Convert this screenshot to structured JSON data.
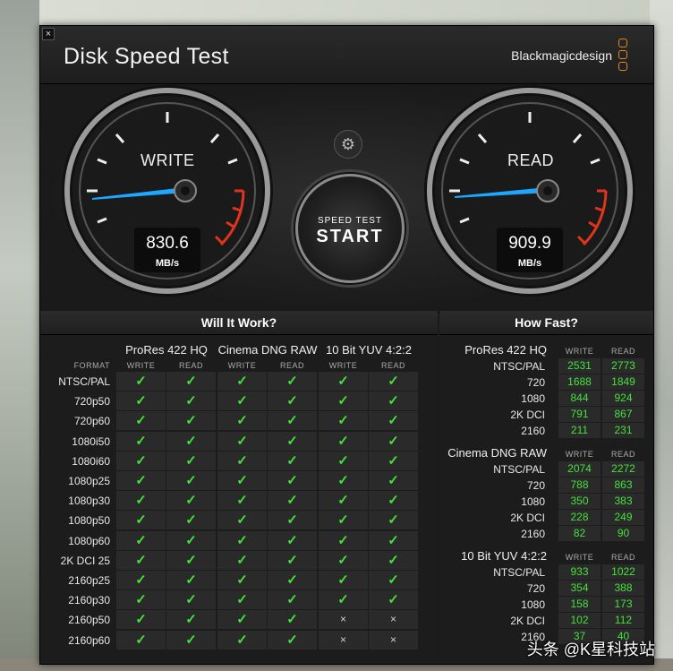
{
  "window": {
    "title": "Disk Speed Test",
    "brand": "Blackmagicdesign",
    "close_label": "×"
  },
  "gauges": {
    "write": {
      "label": "WRITE",
      "value": "830.6",
      "unit": "MB/s"
    },
    "read": {
      "label": "READ",
      "value": "909.9",
      "unit": "MB/s"
    }
  },
  "start_button": {
    "line1": "SPEED TEST",
    "line2": "START"
  },
  "settings_icon": "gear-icon",
  "will_it_work": {
    "header": "Will It Work?",
    "format_label": "FORMAT",
    "codecs": [
      "ProRes 422 HQ",
      "Cinema DNG RAW",
      "10 Bit YUV 4:2:2"
    ],
    "col_labels": [
      "WRITE",
      "READ"
    ],
    "rows": [
      {
        "format": "NTSC/PAL",
        "marks": [
          1,
          1,
          1,
          1,
          1,
          1
        ]
      },
      {
        "format": "720p50",
        "marks": [
          1,
          1,
          1,
          1,
          1,
          1
        ]
      },
      {
        "format": "720p60",
        "marks": [
          1,
          1,
          1,
          1,
          1,
          1
        ]
      },
      {
        "format": "1080i50",
        "marks": [
          1,
          1,
          1,
          1,
          1,
          1
        ]
      },
      {
        "format": "1080i60",
        "marks": [
          1,
          1,
          1,
          1,
          1,
          1
        ]
      },
      {
        "format": "1080p25",
        "marks": [
          1,
          1,
          1,
          1,
          1,
          1
        ]
      },
      {
        "format": "1080p30",
        "marks": [
          1,
          1,
          1,
          1,
          1,
          1
        ]
      },
      {
        "format": "1080p50",
        "marks": [
          1,
          1,
          1,
          1,
          1,
          1
        ]
      },
      {
        "format": "1080p60",
        "marks": [
          1,
          1,
          1,
          1,
          1,
          1
        ]
      },
      {
        "format": "2K DCI 25",
        "marks": [
          1,
          1,
          1,
          1,
          1,
          1
        ]
      },
      {
        "format": "2160p25",
        "marks": [
          1,
          1,
          1,
          1,
          1,
          1
        ]
      },
      {
        "format": "2160p30",
        "marks": [
          1,
          1,
          1,
          1,
          1,
          1
        ]
      },
      {
        "format": "2160p50",
        "marks": [
          1,
          1,
          1,
          1,
          0,
          0
        ]
      },
      {
        "format": "2160p60",
        "marks": [
          1,
          1,
          1,
          1,
          0,
          0
        ]
      }
    ],
    "check_symbol": "✓",
    "cross_symbol": "×"
  },
  "how_fast": {
    "header": "How Fast?",
    "col_labels": [
      "WRITE",
      "READ"
    ],
    "groups": [
      {
        "codec": "ProRes 422 HQ",
        "rows": [
          {
            "format": "NTSC/PAL",
            "write": "2531",
            "read": "2773"
          },
          {
            "format": "720",
            "write": "1688",
            "read": "1849"
          },
          {
            "format": "1080",
            "write": "844",
            "read": "924"
          },
          {
            "format": "2K DCI",
            "write": "791",
            "read": "867"
          },
          {
            "format": "2160",
            "write": "211",
            "read": "231"
          }
        ]
      },
      {
        "codec": "Cinema DNG RAW",
        "rows": [
          {
            "format": "NTSC/PAL",
            "write": "2074",
            "read": "2272"
          },
          {
            "format": "720",
            "write": "788",
            "read": "863"
          },
          {
            "format": "1080",
            "write": "350",
            "read": "383"
          },
          {
            "format": "2K DCI",
            "write": "228",
            "read": "249"
          },
          {
            "format": "2160",
            "write": "82",
            "read": "90"
          }
        ]
      },
      {
        "codec": "10 Bit YUV 4:2:2",
        "rows": [
          {
            "format": "NTSC/PAL",
            "write": "933",
            "read": "1022"
          },
          {
            "format": "720",
            "write": "354",
            "read": "388"
          },
          {
            "format": "1080",
            "write": "158",
            "read": "173"
          },
          {
            "format": "2K DCI",
            "write": "102",
            "read": "112"
          },
          {
            "format": "2160",
            "write": "37",
            "read": "40"
          }
        ]
      }
    ]
  },
  "watermark": "头条 @K星科技站",
  "colors": {
    "accent_green": "#46e13c",
    "needle_blue": "#1ea7ff",
    "brand_orange": "#e08a1c",
    "redline": "#e0341c"
  }
}
